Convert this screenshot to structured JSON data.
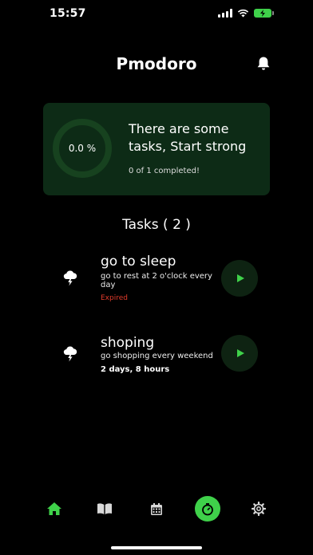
{
  "status_bar": {
    "time": "15:57"
  },
  "header": {
    "title": "Pmodoro",
    "bell_icon": "bell-icon"
  },
  "summary": {
    "progress_text": "0.0 %",
    "progress_fraction": 0.0,
    "message": "There are some tasks, Start strong",
    "count_text": "0 of 1 completed!"
  },
  "tasks_heading": "Tasks ( 2 )",
  "tasks": [
    {
      "title": "go to sleep",
      "description": "go to rest at 2 o'clock every day",
      "status": "Expired",
      "icon": "storm-cloud-icon"
    },
    {
      "title": "shoping",
      "description": "go shopping every weekend",
      "status": "2 days, 8 hours",
      "icon": "storm-cloud-icon"
    }
  ],
  "nav": {
    "items": [
      "home-icon",
      "book-icon",
      "calendar-icon",
      "timer-icon",
      "settings-icon"
    ],
    "active": "home-icon"
  },
  "colors": {
    "accent": "#3fd14a",
    "card_bg": "#0d2b16",
    "expired": "#e23b2b",
    "background": "#000000"
  }
}
